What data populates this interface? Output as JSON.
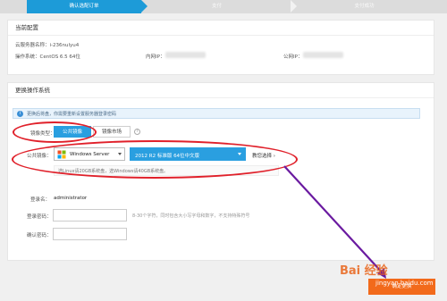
{
  "steps": {
    "step1": "确认选配订单",
    "step2": "支付",
    "step3": "支付成功"
  },
  "current_config": {
    "title": "当前配置",
    "server_name_label": "云服务器名称：i-236nulyu4",
    "os_label": "操作系统：CentOS 6.5 64位",
    "private_ip_label": "内网IP：",
    "public_ip_label": "公网IP："
  },
  "change_os": {
    "title": "更换操作系统",
    "notice": "更换后将盘，你需要重新设置服务器登录密码",
    "image_type_label": "镜像类型：",
    "public_image_tab": "公共镜像",
    "market_image_tab": "镜像市场",
    "public_image_label": "公共镜像：",
    "os_selected": "Windows Server",
    "version_selected": "2012 R2 标准版 64位中文版",
    "free_select": "教您选择 ›",
    "warning": "选Linux请20GB系统盘，选Windows请40GB系统盘。",
    "login_name_label": "登录名：",
    "login_name_value": "administrator",
    "password_label": "登录密码：",
    "password_hint": "8-30个字符，同时包含大小写字母和数字，不支持特殊符号",
    "confirm_password_label": "确认密码："
  },
  "footer": {
    "next_button": "确定更换"
  },
  "watermark": {
    "main": "Bai 经验",
    "sub": "jingyan.baidu.com"
  },
  "colors": {
    "accent": "#2a9fe0",
    "annotation": "#e0202a",
    "arrow": "#6a1aa0",
    "next": "#f26a1b"
  }
}
